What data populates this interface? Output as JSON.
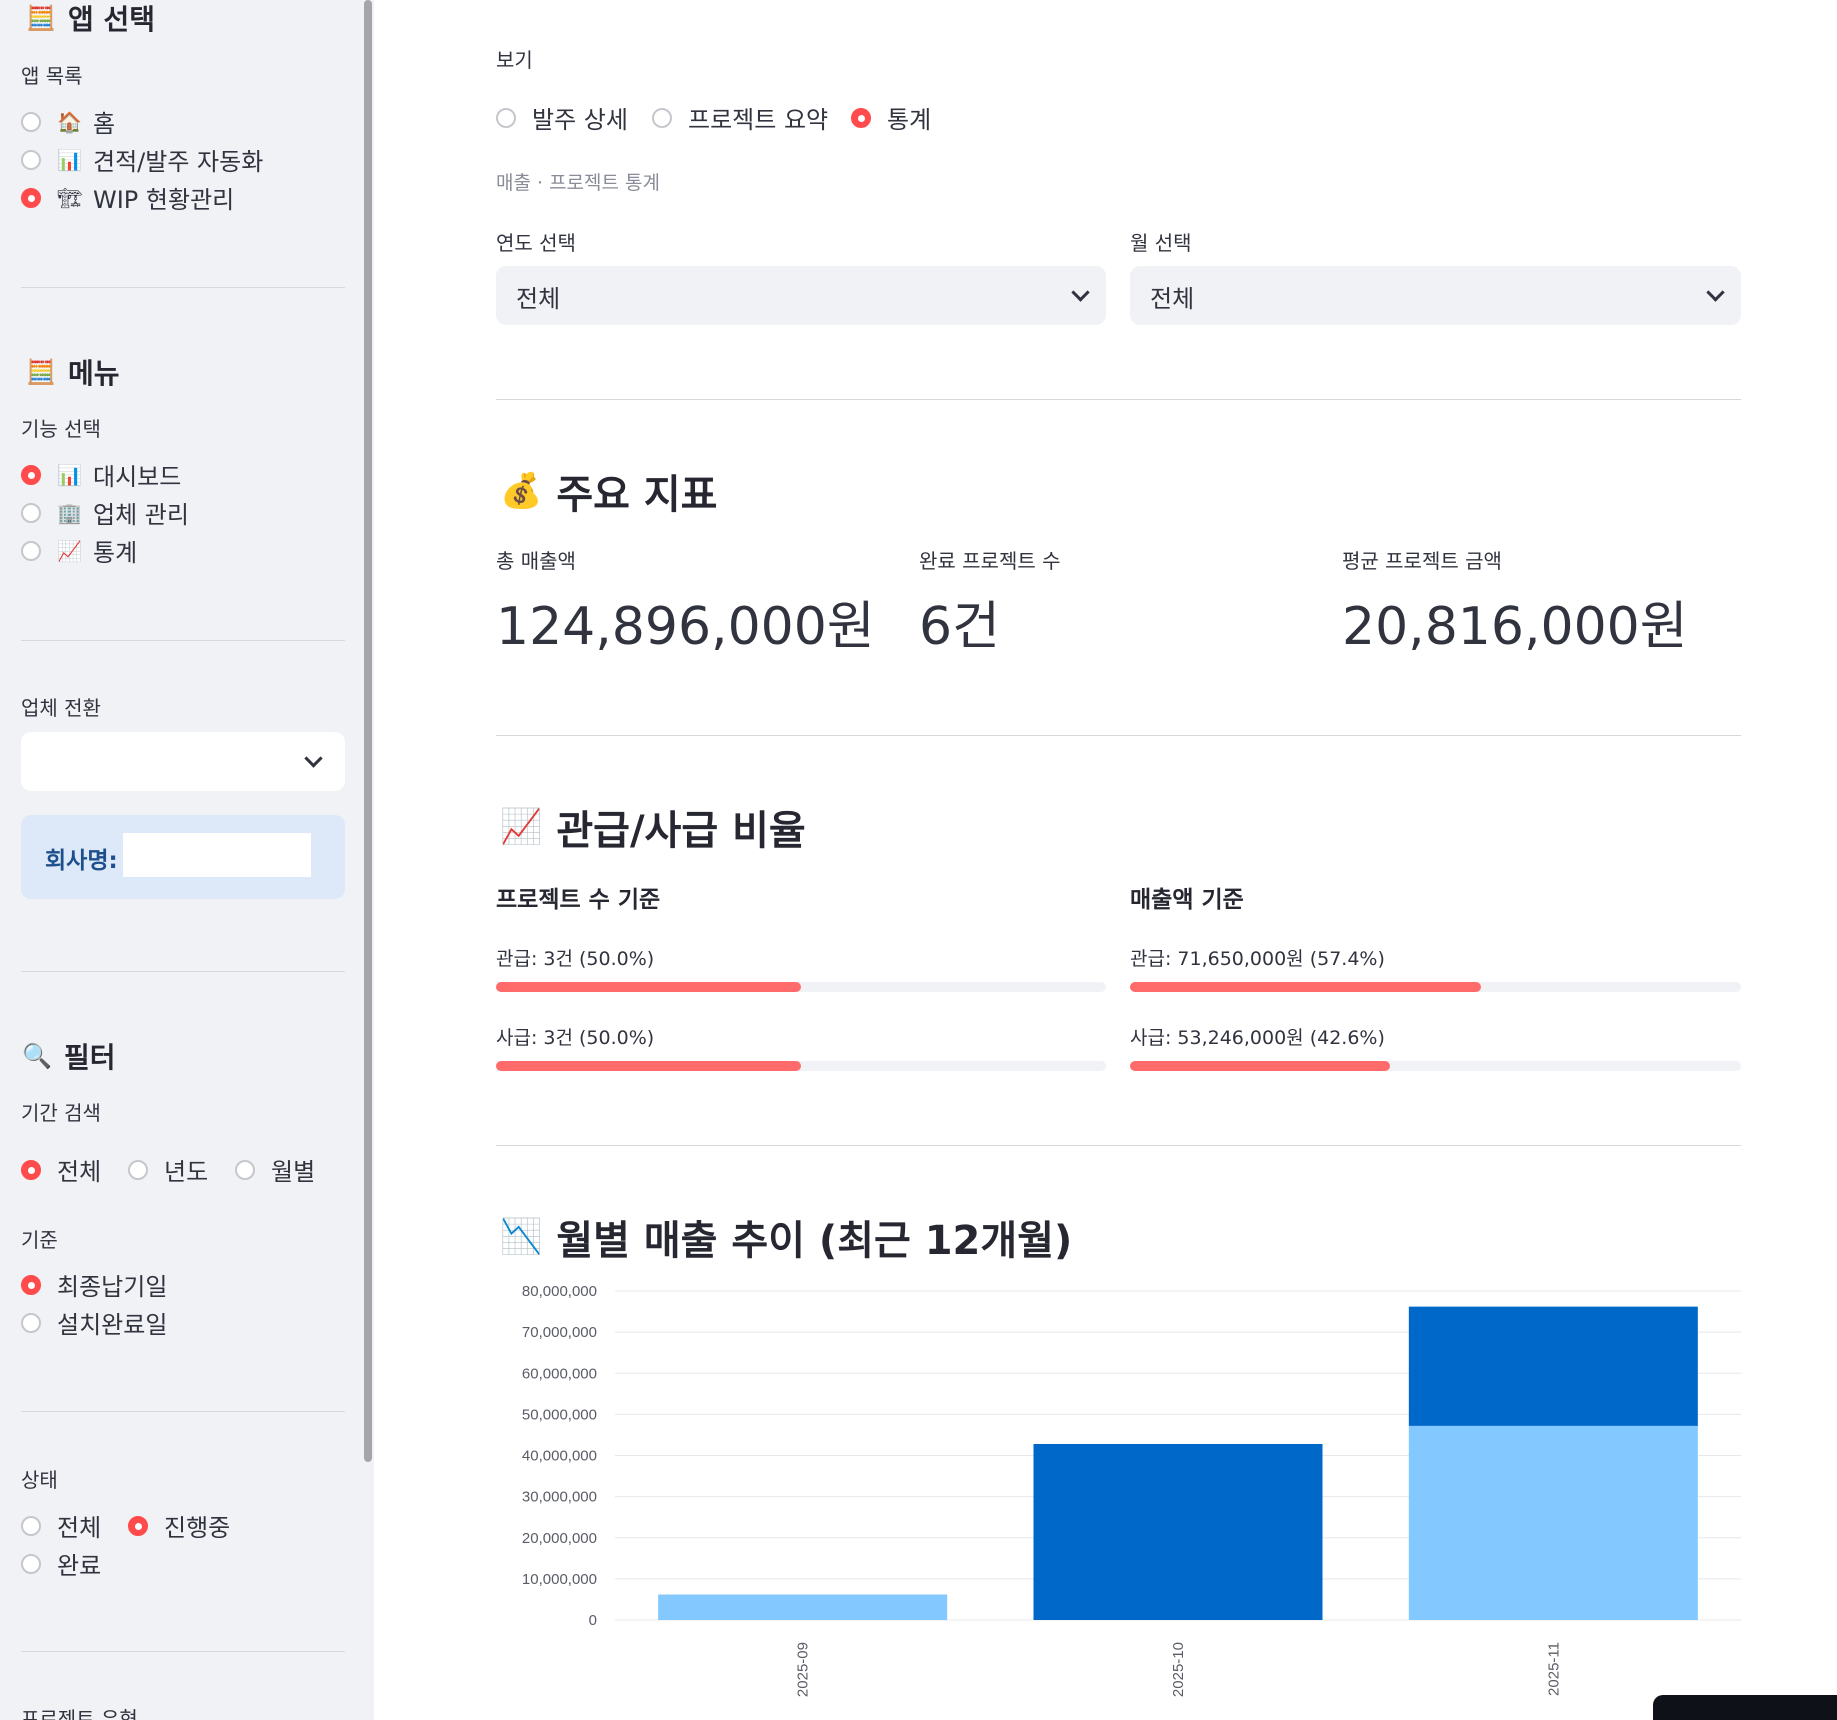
{
  "sidebar": {
    "app_section": {
      "title": "앱 선택",
      "icon": "calculator-icon",
      "list_label": "앱 목록",
      "items": [
        {
          "icon": "🏠",
          "label": "홈",
          "selected": false
        },
        {
          "icon": "📊",
          "label": "견적/발주 자동화",
          "selected": false
        },
        {
          "icon": "🏗",
          "label": "WIP 현황관리",
          "selected": true
        }
      ]
    },
    "menu_section": {
      "title": "메뉴",
      "icon": "calculator-icon",
      "list_label": "기능 선택",
      "items": [
        {
          "icon": "📊",
          "label": "대시보드",
          "selected": true
        },
        {
          "icon": "🏢",
          "label": "업체 관리",
          "selected": false
        },
        {
          "icon": "📈",
          "label": "통계",
          "selected": false
        }
      ]
    },
    "company_switch": {
      "label": "업체 전환",
      "value": "",
      "company_label": "회사명:",
      "company_value": ""
    },
    "filter": {
      "title": "필터",
      "icon": "magnifier-icon",
      "period_label": "기간 검색",
      "period_options": [
        {
          "label": "전체",
          "selected": true
        },
        {
          "label": "년도",
          "selected": false
        },
        {
          "label": "월별",
          "selected": false
        }
      ],
      "basis_label": "기준",
      "basis_options": [
        {
          "label": "최종납기일",
          "selected": true
        },
        {
          "label": "설치완료일",
          "selected": false
        }
      ],
      "status_label": "상태",
      "status_options": [
        {
          "label": "전체",
          "selected": false
        },
        {
          "label": "진행중",
          "selected": true
        },
        {
          "label": "완료",
          "selected": false
        }
      ],
      "project_type_label": "프로젝트 유형"
    }
  },
  "main": {
    "view_label": "보기",
    "view_options": [
      {
        "label": "발주 상세",
        "selected": false
      },
      {
        "label": "프로젝트 요약",
        "selected": false
      },
      {
        "label": "통계",
        "selected": true
      }
    ],
    "caption": "매출 · 프로젝트 통계",
    "year_select": {
      "label": "연도 선택",
      "value": "전체"
    },
    "month_select": {
      "label": "월 선택",
      "value": "전체"
    },
    "kpi": {
      "title": "주요 지표",
      "icon": "money-bag-icon",
      "metrics": [
        {
          "label": "총 매출액",
          "value": "124,896,000원"
        },
        {
          "label": "완료 프로젝트 수",
          "value": "6건"
        },
        {
          "label": "평균 프로젝트 금액",
          "value": "20,816,000원"
        }
      ]
    },
    "ratio": {
      "title": "관급/사급 비율",
      "icon": "chart-increasing-icon",
      "count_heading": "프로젝트 수 기준",
      "amount_heading": "매출액 기준",
      "count_rows": [
        {
          "label": "관급: 3건 (50.0%)",
          "fraction": 0.5
        },
        {
          "label": "사급: 3건 (50.0%)",
          "fraction": 0.5
        }
      ],
      "amount_rows": [
        {
          "label": "관급: 71,650,000원 (57.4%)",
          "fraction": 0.574
        },
        {
          "label": "사급: 53,246,000원 (42.6%)",
          "fraction": 0.426
        }
      ]
    },
    "monthly": {
      "title": "월별 매출 추이 (최근 12개월)",
      "icon": "chart-decreasing-icon"
    }
  },
  "chart_data": {
    "type": "bar",
    "stacked": true,
    "categories": [
      "2025-09",
      "2025-10",
      "2025-11"
    ],
    "series": [
      {
        "color": "#83c9ff",
        "values": [
          6200000,
          0,
          47200000
        ]
      },
      {
        "color": "#0068c9",
        "values": [
          0,
          42800000,
          29000000
        ]
      }
    ],
    "ylim": [
      0,
      80000000
    ],
    "yticks": [
      0,
      10000000,
      20000000,
      30000000,
      40000000,
      50000000,
      60000000,
      70000000,
      80000000
    ],
    "ytick_labels": [
      "0",
      "10,000,000",
      "20,000,000",
      "30,000,000",
      "40,000,000",
      "50,000,000",
      "60,000,000",
      "70,000,000",
      "80,000,000"
    ],
    "grid": true
  }
}
